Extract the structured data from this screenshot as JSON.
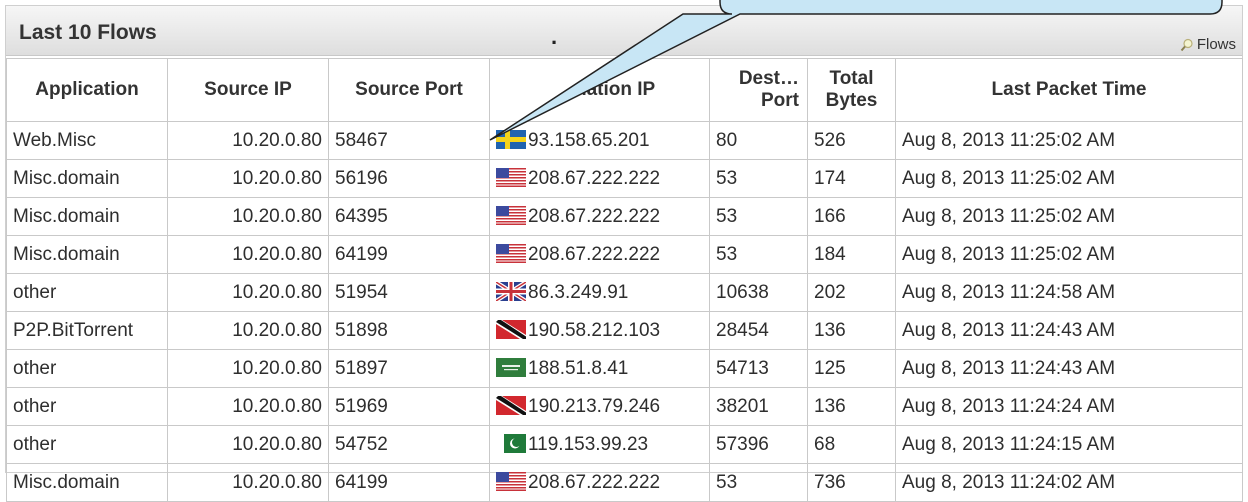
{
  "panel": {
    "title": "Last 10 Flows",
    "dot": ".",
    "flows_link": "Flows",
    "search_icon": "magnifier-icon"
  },
  "table": {
    "headers": {
      "application": "Application",
      "source_ip": "Source IP",
      "source_port": "Source Port",
      "destination_ip": "nation IP",
      "dest_port_line1": "Dest…",
      "dest_port_line2": "Port",
      "total_bytes_line1": "Total",
      "total_bytes_line2": "Bytes",
      "last_packet_time": "Last Packet Time"
    },
    "rows": [
      {
        "app": "Web.Misc",
        "sip": "10.20.0.80",
        "sport": "58467",
        "flag": "se",
        "dip": "93.158.65.201",
        "dport": "80",
        "bytes": "526",
        "time": "Aug 8, 2013 11:25:02 AM"
      },
      {
        "app": "Misc.domain",
        "sip": "10.20.0.80",
        "sport": "56196",
        "flag": "us",
        "dip": "208.67.222.222",
        "dport": "53",
        "bytes": "174",
        "time": "Aug 8, 2013 11:25:02 AM"
      },
      {
        "app": "Misc.domain",
        "sip": "10.20.0.80",
        "sport": "64395",
        "flag": "us",
        "dip": "208.67.222.222",
        "dport": "53",
        "bytes": "166",
        "time": "Aug 8, 2013 11:25:02 AM"
      },
      {
        "app": "Misc.domain",
        "sip": "10.20.0.80",
        "sport": "64199",
        "flag": "us",
        "dip": "208.67.222.222",
        "dport": "53",
        "bytes": "184",
        "time": "Aug 8, 2013 11:25:02 AM"
      },
      {
        "app": "other",
        "sip": "10.20.0.80",
        "sport": "51954",
        "flag": "gb",
        "dip": "86.3.249.91",
        "dport": "10638",
        "bytes": "202",
        "time": "Aug 8, 2013 11:24:58 AM"
      },
      {
        "app": "P2P.BitTorrent",
        "sip": "10.20.0.80",
        "sport": "51898",
        "flag": "tt",
        "dip": "190.58.212.103",
        "dport": "28454",
        "bytes": "136",
        "time": "Aug 8, 2013 11:24:43 AM"
      },
      {
        "app": "other",
        "sip": "10.20.0.80",
        "sport": "51897",
        "flag": "sa",
        "dip": "188.51.8.41",
        "dport": "54713",
        "bytes": "125",
        "time": "Aug 8, 2013 11:24:43 AM"
      },
      {
        "app": "other",
        "sip": "10.20.0.80",
        "sport": "51969",
        "flag": "tt",
        "dip": "190.213.79.246",
        "dport": "38201",
        "bytes": "136",
        "time": "Aug 8, 2013 11:24:24 AM"
      },
      {
        "app": "other",
        "sip": "10.20.0.80",
        "sport": "54752",
        "flag": "pk",
        "dip": "119.153.99.23",
        "dport": "57396",
        "bytes": "68",
        "time": "Aug 8, 2013 11:24:15 AM"
      },
      {
        "app": "Misc.domain",
        "sip": "10.20.0.80",
        "sport": "64199",
        "flag": "us",
        "dip": "208.67.222.222",
        "dport": "53",
        "bytes": "736",
        "time": "Aug 8, 2013 11:24:02 AM"
      }
    ]
  },
  "colors": {
    "callout_fill": "#c8e6f5",
    "callout_stroke": "#222222",
    "grid": "#c9c9c9"
  }
}
